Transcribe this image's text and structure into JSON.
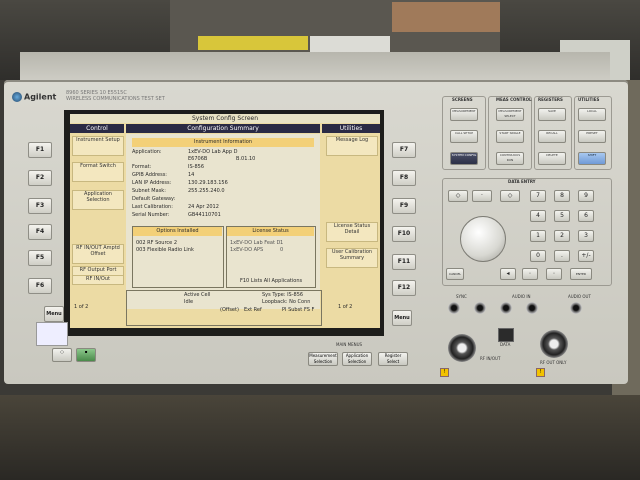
{
  "instrument": {
    "brand": "Agilent",
    "series_line1": "8960 SERIES 10",
    "series_line2": "WIRELESS COMMUNICATIONS TEST SET",
    "series_model": "E5515C"
  },
  "screen": {
    "title": "System Config Screen",
    "left_header": "Control",
    "center_header": "Configuration Summary",
    "right_header": "Utilities",
    "info_header": "Instrument Information",
    "info": [
      {
        "key": "Application:",
        "value": "1xEV-DO Lab App D",
        "value2": ""
      },
      {
        "key": "",
        "value": "E6706B",
        "value2": "B.01.10"
      },
      {
        "key": "Format:",
        "value": "IS-856",
        "value2": ""
      },
      {
        "key": "GPIB Address:",
        "value": "14",
        "value2": ""
      },
      {
        "key": "LAN IP Address:",
        "value": "130.29.183.156",
        "value2": ""
      },
      {
        "key": "Subnet Mask:",
        "value": "255.255.240.0",
        "value2": ""
      },
      {
        "key": "Default Gateway:",
        "value": "",
        "value2": ""
      },
      {
        "key": "Last Calibration:",
        "value": "24 Apr 2012",
        "value2": ""
      },
      {
        "key": "Serial Number:",
        "value": "GB44110701",
        "value2": ""
      }
    ],
    "options_header": "Options Installed",
    "options": [
      "002 RF Source 2",
      "003 Flexible Radio Link"
    ],
    "license_header": "License Status",
    "license_rows": [
      "1xEV-DO Lab Feat D",
      "1xEV-DO APS"
    ],
    "license_values": [
      "1",
      "0"
    ],
    "license_footer": "F10 Lists All Applications",
    "left_softkeys": [
      "Instrument Setup",
      "Format Switch",
      "Application Selection",
      "RF IN/OUT Amptd Offset",
      "RF Output Port",
      "RF IN/Out"
    ],
    "right_softkeys": [
      "Message Log",
      "License Status Detail",
      "User Calibration Summary"
    ],
    "page_left": "1 of 2",
    "page_right": "1 of 2",
    "status_active_cell_label": "Active Cell",
    "status_active_cell_value": "Idle",
    "status_sys_type": "Sys Type: IS-856",
    "status_loopback": "Loopback: No Conn",
    "status_offset": "(Offset)",
    "status_ext_ref": "Ext Ref",
    "status_pi_subst": "PI Subst",
    "status_fs": "FS  F"
  },
  "left_fkeys": [
    "F1",
    "F2",
    "F3",
    "F4",
    "F5",
    "F6"
  ],
  "right_fkeys": [
    "F7",
    "F8",
    "F9",
    "F10",
    "F11",
    "F12"
  ],
  "menu_left": "Menu",
  "menu_right": "Menu",
  "panel": {
    "screens_label": "SCREENS",
    "meas_label": "MEAS CONTROL",
    "registers_label": "REGISTERS",
    "utilities_label": "UTILITIES",
    "measurement": "MEASUREMENT",
    "call_setup": "CALL SETUP",
    "system_config": "SYSTEM CONFIG",
    "meas_selection": "MEASUREMENT SELECT",
    "start_single": "START SINGLE",
    "continuous": "CONTINUOUS RUN",
    "save": "SAVE",
    "recall": "RECALL",
    "delete": "DELETE",
    "local": "LOCAL",
    "preset": "PRESET",
    "shift": "SHIFT",
    "data_entry": "DATA ENTRY",
    "keys": [
      "7",
      "8",
      "9",
      "4",
      "5",
      "6",
      "1",
      "2",
      "3",
      "0",
      ".",
      "+/-"
    ],
    "cancel": "CANCEL",
    "enter": "ENTER",
    "audio_in": "AUDIO IN",
    "audio_out": "AUDIO OUT",
    "rf_in_out": "RF IN/OUT",
    "rf_out_only": "RF OUT ONLY",
    "data": "DATA",
    "sync": "SYNC",
    "qual": "QUAL",
    "mode_label": "MAIN MENUS",
    "bottom_btns": [
      "Measurement Selection",
      "Application Selection",
      "Register Select"
    ]
  },
  "colors": {
    "lcd": "#ecdba4",
    "header": "#2a2a44",
    "accent": "#f3d078"
  }
}
